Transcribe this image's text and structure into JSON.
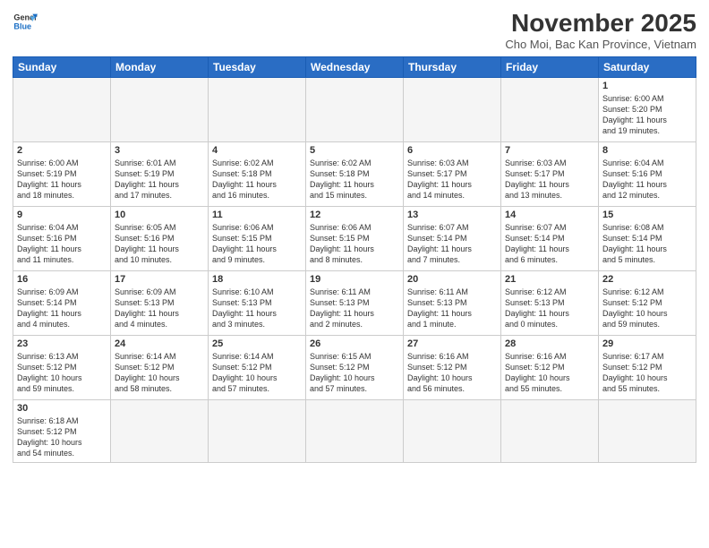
{
  "logo": {
    "text_general": "General",
    "text_blue": "Blue"
  },
  "header": {
    "month": "November 2025",
    "location": "Cho Moi, Bac Kan Province, Vietnam"
  },
  "weekdays": [
    "Sunday",
    "Monday",
    "Tuesday",
    "Wednesday",
    "Thursday",
    "Friday",
    "Saturday"
  ],
  "days": {
    "d1": {
      "num": "1",
      "info": "Sunrise: 6:00 AM\nSunset: 5:20 PM\nDaylight: 11 hours\nand 19 minutes."
    },
    "d2": {
      "num": "2",
      "info": "Sunrise: 6:00 AM\nSunset: 5:19 PM\nDaylight: 11 hours\nand 18 minutes."
    },
    "d3": {
      "num": "3",
      "info": "Sunrise: 6:01 AM\nSunset: 5:19 PM\nDaylight: 11 hours\nand 17 minutes."
    },
    "d4": {
      "num": "4",
      "info": "Sunrise: 6:02 AM\nSunset: 5:18 PM\nDaylight: 11 hours\nand 16 minutes."
    },
    "d5": {
      "num": "5",
      "info": "Sunrise: 6:02 AM\nSunset: 5:18 PM\nDaylight: 11 hours\nand 15 minutes."
    },
    "d6": {
      "num": "6",
      "info": "Sunrise: 6:03 AM\nSunset: 5:17 PM\nDaylight: 11 hours\nand 14 minutes."
    },
    "d7": {
      "num": "7",
      "info": "Sunrise: 6:03 AM\nSunset: 5:17 PM\nDaylight: 11 hours\nand 13 minutes."
    },
    "d8": {
      "num": "8",
      "info": "Sunrise: 6:04 AM\nSunset: 5:16 PM\nDaylight: 11 hours\nand 12 minutes."
    },
    "d9": {
      "num": "9",
      "info": "Sunrise: 6:04 AM\nSunset: 5:16 PM\nDaylight: 11 hours\nand 11 minutes."
    },
    "d10": {
      "num": "10",
      "info": "Sunrise: 6:05 AM\nSunset: 5:16 PM\nDaylight: 11 hours\nand 10 minutes."
    },
    "d11": {
      "num": "11",
      "info": "Sunrise: 6:06 AM\nSunset: 5:15 PM\nDaylight: 11 hours\nand 9 minutes."
    },
    "d12": {
      "num": "12",
      "info": "Sunrise: 6:06 AM\nSunset: 5:15 PM\nDaylight: 11 hours\nand 8 minutes."
    },
    "d13": {
      "num": "13",
      "info": "Sunrise: 6:07 AM\nSunset: 5:14 PM\nDaylight: 11 hours\nand 7 minutes."
    },
    "d14": {
      "num": "14",
      "info": "Sunrise: 6:07 AM\nSunset: 5:14 PM\nDaylight: 11 hours\nand 6 minutes."
    },
    "d15": {
      "num": "15",
      "info": "Sunrise: 6:08 AM\nSunset: 5:14 PM\nDaylight: 11 hours\nand 5 minutes."
    },
    "d16": {
      "num": "16",
      "info": "Sunrise: 6:09 AM\nSunset: 5:14 PM\nDaylight: 11 hours\nand 4 minutes."
    },
    "d17": {
      "num": "17",
      "info": "Sunrise: 6:09 AM\nSunset: 5:13 PM\nDaylight: 11 hours\nand 4 minutes."
    },
    "d18": {
      "num": "18",
      "info": "Sunrise: 6:10 AM\nSunset: 5:13 PM\nDaylight: 11 hours\nand 3 minutes."
    },
    "d19": {
      "num": "19",
      "info": "Sunrise: 6:11 AM\nSunset: 5:13 PM\nDaylight: 11 hours\nand 2 minutes."
    },
    "d20": {
      "num": "20",
      "info": "Sunrise: 6:11 AM\nSunset: 5:13 PM\nDaylight: 11 hours\nand 1 minute."
    },
    "d21": {
      "num": "21",
      "info": "Sunrise: 6:12 AM\nSunset: 5:13 PM\nDaylight: 11 hours\nand 0 minutes."
    },
    "d22": {
      "num": "22",
      "info": "Sunrise: 6:12 AM\nSunset: 5:12 PM\nDaylight: 10 hours\nand 59 minutes."
    },
    "d23": {
      "num": "23",
      "info": "Sunrise: 6:13 AM\nSunset: 5:12 PM\nDaylight: 10 hours\nand 59 minutes."
    },
    "d24": {
      "num": "24",
      "info": "Sunrise: 6:14 AM\nSunset: 5:12 PM\nDaylight: 10 hours\nand 58 minutes."
    },
    "d25": {
      "num": "25",
      "info": "Sunrise: 6:14 AM\nSunset: 5:12 PM\nDaylight: 10 hours\nand 57 minutes."
    },
    "d26": {
      "num": "26",
      "info": "Sunrise: 6:15 AM\nSunset: 5:12 PM\nDaylight: 10 hours\nand 57 minutes."
    },
    "d27": {
      "num": "27",
      "info": "Sunrise: 6:16 AM\nSunset: 5:12 PM\nDaylight: 10 hours\nand 56 minutes."
    },
    "d28": {
      "num": "28",
      "info": "Sunrise: 6:16 AM\nSunset: 5:12 PM\nDaylight: 10 hours\nand 55 minutes."
    },
    "d29": {
      "num": "29",
      "info": "Sunrise: 6:17 AM\nSunset: 5:12 PM\nDaylight: 10 hours\nand 55 minutes."
    },
    "d30": {
      "num": "30",
      "info": "Sunrise: 6:18 AM\nSunset: 5:12 PM\nDaylight: 10 hours\nand 54 minutes."
    }
  }
}
